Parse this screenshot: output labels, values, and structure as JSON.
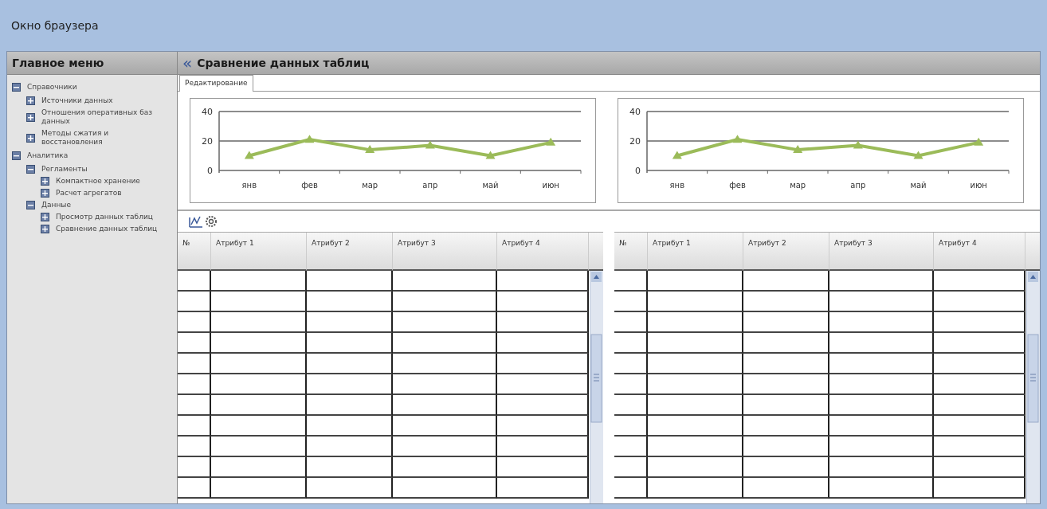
{
  "window": {
    "title": "Окно браузера"
  },
  "sidebar": {
    "title": "Главное меню",
    "items": [
      {
        "label": "Справочники",
        "expanded": true,
        "children": [
          {
            "label": "Источники данных",
            "expanded": false
          },
          {
            "label": "Отношения оперативных баз данных",
            "expanded": false
          },
          {
            "label": "Методы сжатия и восстановления",
            "expanded": false
          }
        ]
      },
      {
        "label": "Аналитика",
        "expanded": true,
        "children": [
          {
            "label": "Регламенты",
            "expanded": true,
            "children": [
              {
                "label": "Компактное хранение",
                "expanded": false
              },
              {
                "label": "Расчет агрегатов",
                "expanded": false
              }
            ]
          },
          {
            "label": "Данные",
            "expanded": true,
            "children": [
              {
                "label": "Просмотр данных таблиц",
                "expanded": false
              },
              {
                "label": "Сравнение данных таблиц",
                "expanded": false
              }
            ]
          }
        ]
      }
    ]
  },
  "page": {
    "back_icon": "«",
    "title": "Сравнение данных таблиц"
  },
  "tabs": [
    {
      "label": "Редактирование",
      "selected": true
    }
  ],
  "charts": [
    {
      "chart_data": {
        "type": "line",
        "categories": [
          "янв",
          "фев",
          "мар",
          "апр",
          "май",
          "июн"
        ],
        "ylim": [
          0,
          40
        ],
        "yticks": [
          0,
          20,
          40
        ],
        "series": [
          {
            "color": "#9bbb59",
            "marker": "triangle",
            "values": [
              10,
              21,
              14,
              17,
              10,
              19
            ]
          }
        ]
      }
    },
    {
      "chart_data": {
        "type": "line",
        "categories": [
          "янв",
          "фев",
          "мар",
          "апр",
          "май",
          "июн"
        ],
        "ylim": [
          0,
          40
        ],
        "yticks": [
          0,
          20,
          40
        ],
        "series": [
          {
            "color": "#9bbb59",
            "marker": "triangle",
            "values": [
              10,
              21,
              14,
              17,
              10,
              19
            ]
          }
        ]
      }
    }
  ],
  "tables": [
    {
      "columns": [
        "№",
        "Атрибут 1",
        "Атрибут 2",
        "Атрибут 3",
        "Атрибут 4"
      ]
    },
    {
      "columns": [
        "№",
        "Атрибут 1",
        "Атрибут 2",
        "Атрибут 3",
        "Атрибут 4"
      ]
    }
  ]
}
